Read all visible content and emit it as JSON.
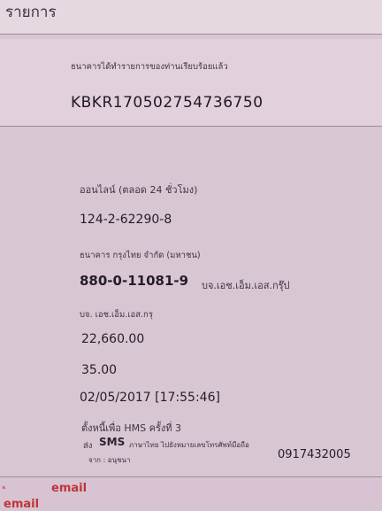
{
  "header": {
    "title": "รายการ"
  },
  "confirmation": {
    "message": "ธนาคารได้ทำรายการของท่านเรียบร้อยแล้ว",
    "reference": "KBKR170502754736750"
  },
  "details": {
    "service": "ออนไลน์ (ตลอด 24 ชั่วโมง)",
    "from_account": "124-2-62290-8",
    "bank": "ธนาคาร กรุงไทย จำกัด (มหาชน)",
    "to_account": "880-0-11081-9",
    "to_account_name": "บจ.เอช.เอ็ม.เอส.กรุ๊ป",
    "recipient_name": "บจ. เอช.เอ็ม.เอส.กรุ",
    "amount": "22,660.00",
    "fee": "35.00",
    "datetime": "02/05/2017 [17:55:46]",
    "memo": "ตั้งหนี้เพื่อ HMS ครั้งที่ 3",
    "sms_label": "SMS",
    "sms_text": "ภาษาไทย ไปยังหมายเลขโทรศัพท์มือถือ",
    "sms_prefix": "ส่ง",
    "phone": "0917432005",
    "sender": "จาก : อนุชนา"
  },
  "footer": {
    "line1_email": "email",
    "line2_email": "email"
  },
  "colors": {
    "background": "#d9c6d3",
    "panel": "#e2d1dc",
    "footer_red": "#c0353a"
  }
}
